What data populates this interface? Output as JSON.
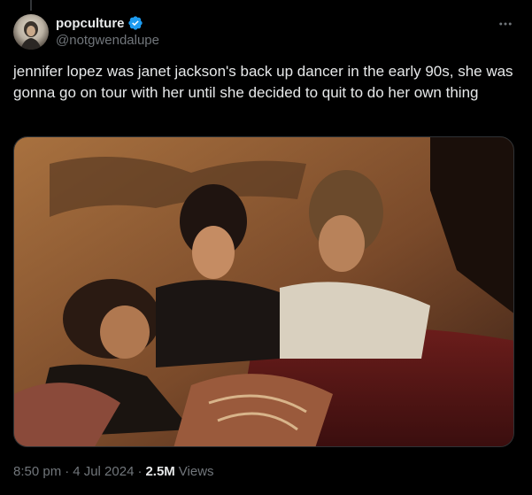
{
  "author": {
    "display_name": "popculture",
    "handle": "@notgwendalupe",
    "verified": true
  },
  "tweet": {
    "text": "jennifer lopez was janet jackson's back up dancer in the early 90s, she was gonna go on tour with her until she decided to quit to do her own thing"
  },
  "media": {
    "icon": "photo"
  },
  "meta": {
    "time": "8:50 pm",
    "separator": "·",
    "date": "4 Jul 2024",
    "views_count": "2.5M",
    "views_label": "Views"
  },
  "colors": {
    "background": "#000000",
    "text": "#e7e9ea",
    "secondary": "#71767b",
    "verified": "#1d9bf0",
    "border": "#2f3336"
  }
}
